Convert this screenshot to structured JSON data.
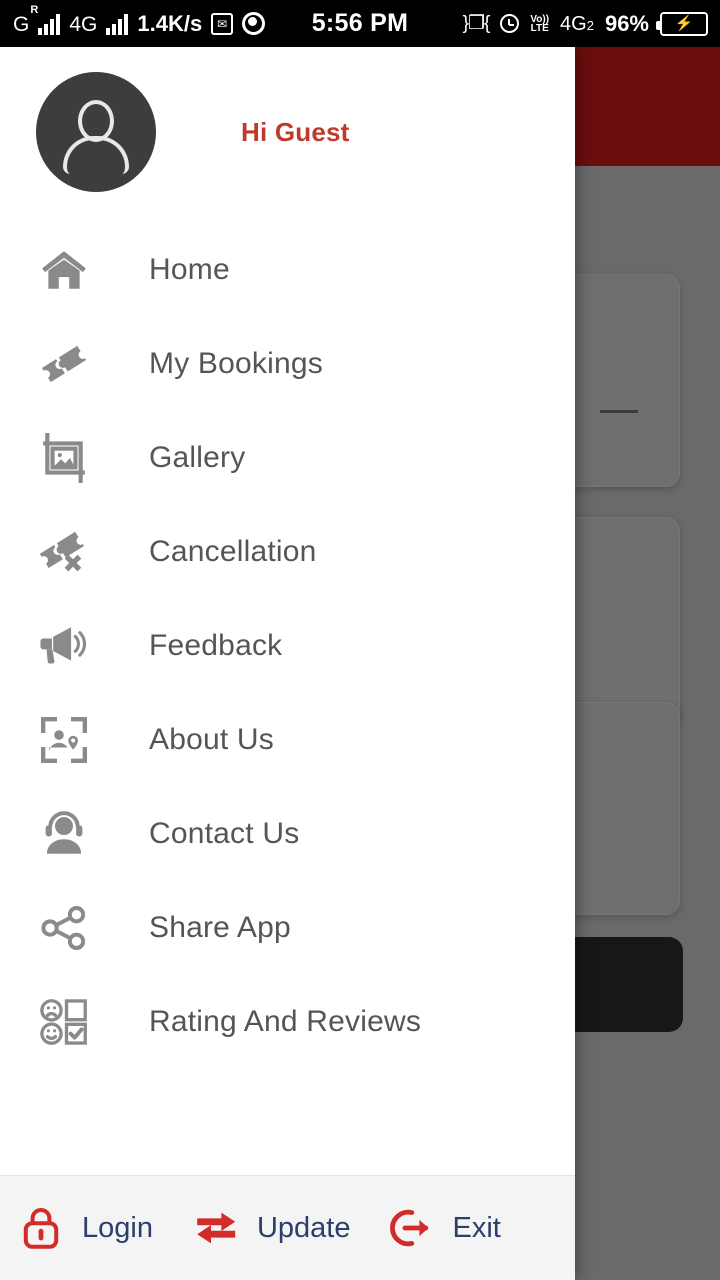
{
  "status_bar": {
    "carrier": "G",
    "roaming_superscript": "R",
    "network_type": "4G",
    "data_speed": "1.4K/s",
    "mail_icon": "mail-icon",
    "chrome_icon": "chrome-icon",
    "time": "5:56 PM",
    "vibrate_icon": "vibrate-icon",
    "alarm_icon": "alarm-icon",
    "volte_line1": "Vo))",
    "volte_line2": "LTE",
    "sim2_network": "4G",
    "sim2_index": "2",
    "battery_percent": "96%",
    "charging_icon": "charging-bolt-icon"
  },
  "drawer": {
    "profile": {
      "avatar_icon": "user-avatar-icon",
      "greeting": "Hi Guest",
      "greeting_color": "#c0392b"
    },
    "menu_items": [
      {
        "label": "Home",
        "icon": "home-icon"
      },
      {
        "label": "My Bookings",
        "icon": "ticket-icon"
      },
      {
        "label": "Gallery",
        "icon": "gallery-image-icon"
      },
      {
        "label": "Cancellation",
        "icon": "ticket-cancel-icon"
      },
      {
        "label": "Feedback",
        "icon": "megaphone-icon"
      },
      {
        "label": "About Us",
        "icon": "person-location-frame-icon"
      },
      {
        "label": "Contact Us",
        "icon": "headset-support-icon"
      },
      {
        "label": "Share App",
        "icon": "share-nodes-icon"
      },
      {
        "label": "Rating And Reviews",
        "icon": "rating-faces-checkbox-icon"
      }
    ],
    "bottom_actions": [
      {
        "label": "Login",
        "icon": "padlock-icon"
      },
      {
        "label": "Update",
        "icon": "swap-arrows-icon"
      },
      {
        "label": "Exit",
        "icon": "logout-arrow-icon"
      }
    ],
    "accent_color": "#d32a2a",
    "action_label_color": "#2c3e6b"
  },
  "background": {
    "header_color": "#6b0d0d",
    "scrim_color": "#6a6a6a",
    "download_icon": "download-circle-icon"
  }
}
